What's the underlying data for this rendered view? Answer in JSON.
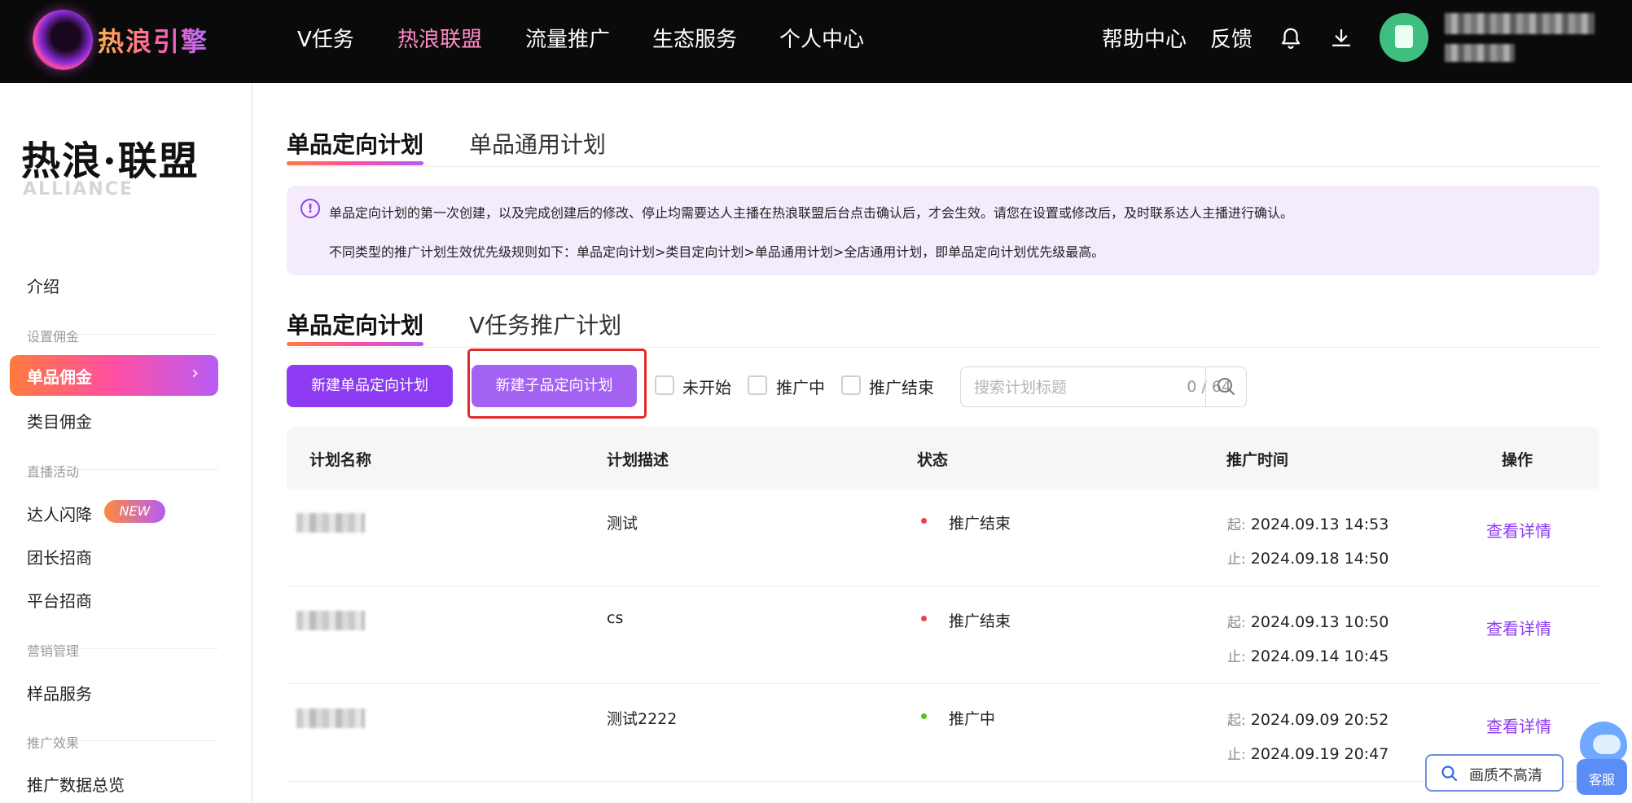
{
  "header": {
    "logo_text": "热浪引擎",
    "nav": [
      "V任务",
      "热浪联盟",
      "流量推广",
      "生态服务",
      "个人中心"
    ],
    "active_nav": "热浪联盟",
    "help": "帮助中心",
    "feedback": "反馈"
  },
  "sidebar": {
    "brand_cn": "热浪·联盟",
    "brand_en": "ALLIANCE",
    "intro": "介绍",
    "group_commission": "设置佣金",
    "single_commission": "单品佣金",
    "category_commission": "类目佣金",
    "group_live": "直播活动",
    "talent_flash": "达人闪降",
    "new_badge": "NEW",
    "leader_recruit": "团长招商",
    "platform_recruit": "平台招商",
    "group_marketing": "营销管理",
    "sample_service": "样品服务",
    "group_effect": "推广效果",
    "data_overview": "推广数据总览"
  },
  "main": {
    "top_tabs": [
      "单品定向计划",
      "单品通用计划"
    ],
    "notice": {
      "line1": "单品定向计划的第一次创建，以及完成创建后的修改、停止均需要达人主播在热浪联盟后台点击确认后，才会生效。请您在设置或修改后，及时联系达人主播进行确认。",
      "line2": "不同类型的推广计划生效优先级规则如下：单品定向计划>类目定向计划>单品通用计划>全店通用计划，即单品定向计划优先级最高。"
    },
    "sub_tabs": [
      "单品定向计划",
      "V任务推广计划"
    ],
    "btn_new_plan": "新建单品定向计划",
    "btn_new_sub_plan": "新建子品定向计划",
    "filters": [
      "未开始",
      "推广中",
      "推广结束"
    ],
    "search": {
      "placeholder": "搜索计划标题",
      "counter": "0 / 64"
    },
    "table": {
      "headers": [
        "计划名称",
        "计划描述",
        "状态",
        "推广时间",
        "操作"
      ],
      "rows": [
        {
          "desc": "测试",
          "status": "推广结束",
          "start_label": "起:",
          "start": "2024.09.13 14:53",
          "end_label": "止:",
          "end": "2024.09.18 14:50",
          "action": "查看详情"
        },
        {
          "desc": "cs",
          "status": "推广结束",
          "start_label": "起:",
          "start": "2024.09.13 10:50",
          "end_label": "止:",
          "end": "2024.09.14 10:45",
          "action": "查看详情"
        },
        {
          "desc": "测试2222",
          "status": "推广中",
          "start_label": "起:",
          "start": "2024.09.09 20:52",
          "end_label": "止:",
          "end": "2024.09.19 20:47",
          "action": "查看详情"
        }
      ]
    }
  },
  "floating": {
    "quality_btn": "画质不高清",
    "service_label": "客服"
  },
  "colors": {
    "accent_purple": "#8c3bf2",
    "status_ended": "#e8463c",
    "status_active": "#52c41a",
    "highlight_box": "#e02b2b"
  }
}
